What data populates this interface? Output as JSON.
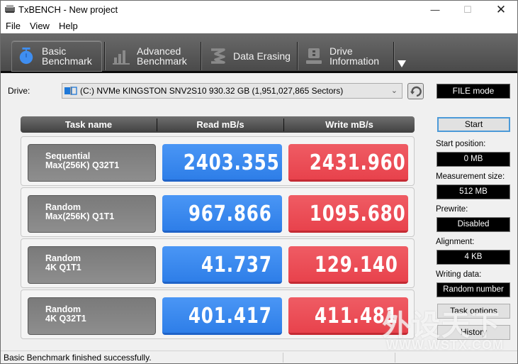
{
  "window": {
    "title": "TxBENCH - New project",
    "controls": {
      "minimize": "—",
      "maximize": "☐",
      "close": "✕"
    }
  },
  "menu": [
    "File",
    "View",
    "Help"
  ],
  "toolbar": {
    "tabs": [
      {
        "line1": "Basic",
        "line2": "Benchmark",
        "icon": "stopwatch-icon",
        "active": true
      },
      {
        "line1": "Advanced",
        "line2": "Benchmark",
        "icon": "bar-chart-icon",
        "active": false
      },
      {
        "line1": "Data Erasing",
        "line2": "",
        "icon": "eraser-icon",
        "active": false
      },
      {
        "line1": "Drive",
        "line2": "Information",
        "icon": "drive-info-icon",
        "active": false
      }
    ],
    "more": "more-tabs"
  },
  "drive": {
    "label": "Drive:",
    "selected": "(C:) NVMe KINGSTON SNV2S10  930.32 GB (1,951,027,865 Sectors)",
    "mode": "FILE mode"
  },
  "table": {
    "headers": [
      "Task name",
      "Read mB/s",
      "Write mB/s"
    ],
    "rows": [
      {
        "line1": "Sequential",
        "line2": "Max(256K) Q32T1",
        "read": "2403.355",
        "write": "2431.960"
      },
      {
        "line1": "Random",
        "line2": "Max(256K) Q1T1",
        "read": "967.866",
        "write": "1095.680"
      },
      {
        "line1": "Random",
        "line2": "4K Q1T1",
        "read": "41.737",
        "write": "129.140"
      },
      {
        "line1": "Random",
        "line2": "4K Q32T1",
        "read": "401.417",
        "write": "411.481"
      }
    ]
  },
  "side": {
    "start": "Start",
    "start_position_label": "Start position:",
    "start_position": "0 MB",
    "measurement_size_label": "Measurement size:",
    "measurement_size": "512 MB",
    "prewrite_label": "Prewrite:",
    "prewrite": "Disabled",
    "alignment_label": "Alignment:",
    "alignment": "4 KB",
    "writing_data_label": "Writing data:",
    "writing_data": "Random number",
    "task_options": "Task options",
    "history": "History"
  },
  "status": {
    "text": "Basic Benchmark finished successfully."
  },
  "watermark": {
    "cn": "外设天下",
    "url": "WWW.WSTX.COM"
  },
  "colors": {
    "read": "#3b8bf0",
    "write": "#ec4f58",
    "toolbar": "#555555",
    "active_icon": "#3f8ef0"
  }
}
